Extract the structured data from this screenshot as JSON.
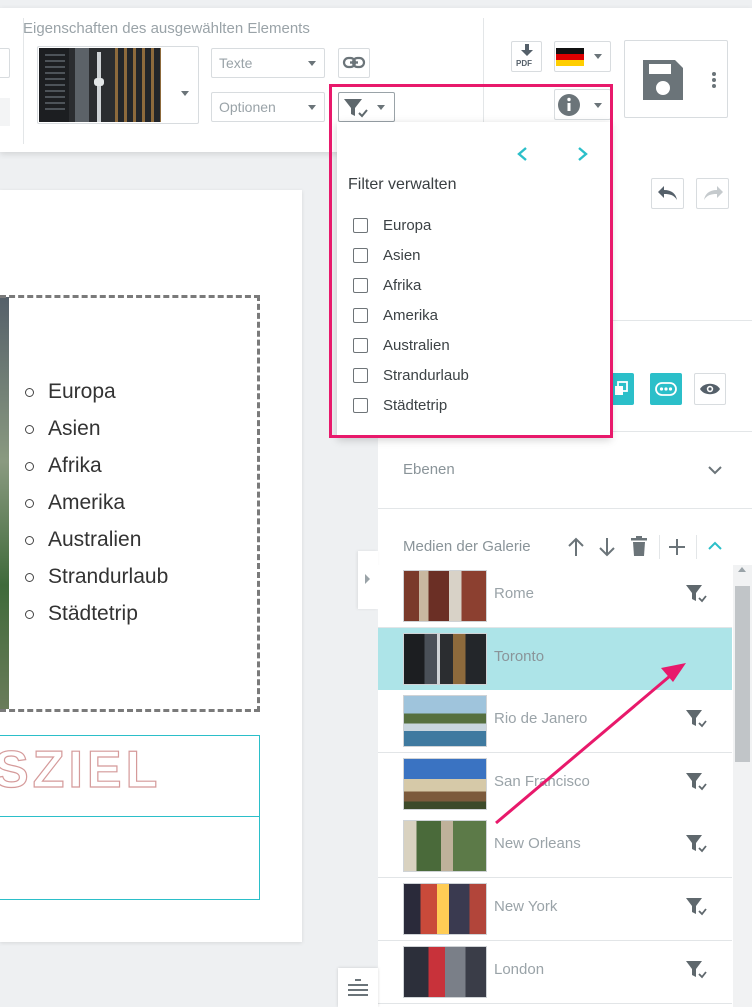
{
  "toolbar": {
    "properties_title": "Eigenschaften des ausgewählten Elements",
    "texts_dropdown": "Texte",
    "options_dropdown": "Optionen",
    "pdf_label": "PDF"
  },
  "filter_popup": {
    "title": "Filter verwalten",
    "items": [
      {
        "label": "Europa",
        "checked": false
      },
      {
        "label": "Asien",
        "checked": false
      },
      {
        "label": "Afrika",
        "checked": false
      },
      {
        "label": "Amerika",
        "checked": false
      },
      {
        "label": "Australien",
        "checked": false
      },
      {
        "label": "Strandurlaub",
        "checked": false
      },
      {
        "label": "Städtetrip",
        "checked": false
      }
    ]
  },
  "canvas": {
    "list_items": [
      "Europa",
      "Asien",
      "Afrika",
      "Amerika",
      "Australien",
      "Strandurlaub",
      "Städtetrip"
    ],
    "headline_fragment": "SZIEL"
  },
  "right_panel": {
    "layers_label": "Ebenen",
    "gallery_label": "Medien der Galerie",
    "media": [
      {
        "name": "Rome",
        "selected": false
      },
      {
        "name": "Toronto",
        "selected": true
      },
      {
        "name": "Rio de Janero",
        "selected": false
      },
      {
        "name": "San Francisco",
        "selected": false
      },
      {
        "name": "New Orleans",
        "selected": false
      },
      {
        "name": "New York",
        "selected": false
      },
      {
        "name": "London",
        "selected": false
      }
    ]
  },
  "colors": {
    "accent_teal": "#2bbfc9",
    "highlight_pink": "#e8196b",
    "selected_row": "#ade4e8"
  }
}
